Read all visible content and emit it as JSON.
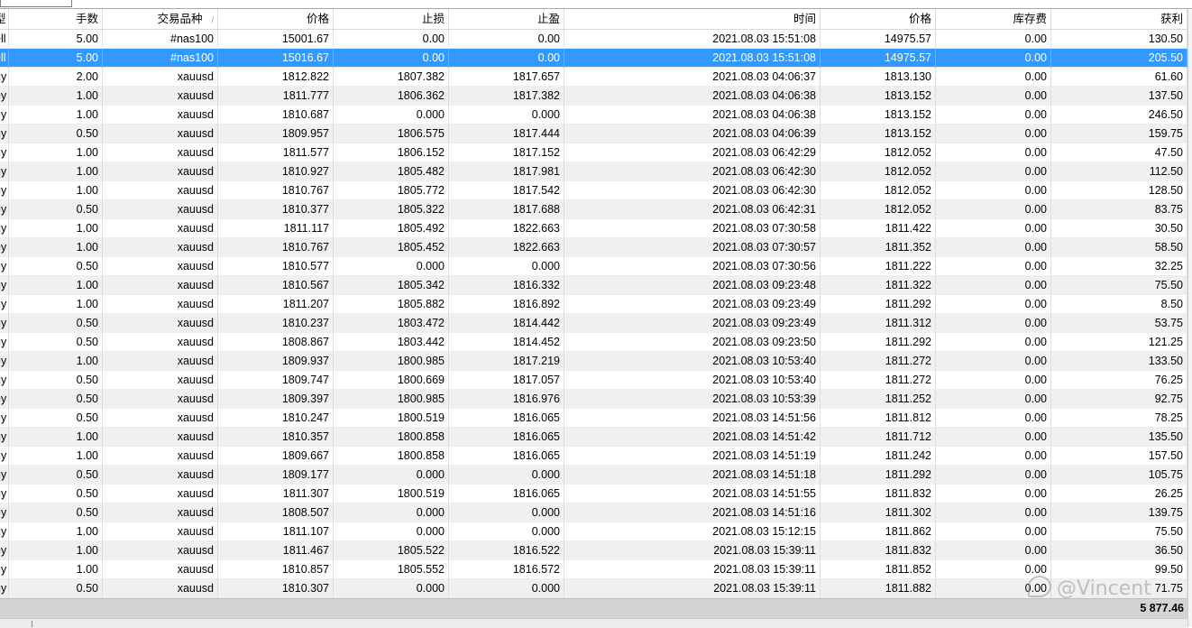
{
  "columns": {
    "type": "型",
    "lots": "手数",
    "symbol": "交易品种",
    "open_price": "价格",
    "sl": "止损",
    "tp": "止盈",
    "time": "时间",
    "price": "价格",
    "swap": "库存费",
    "profit": "获利"
  },
  "sort_indicator": "/",
  "rows": [
    [
      "ell",
      "5.00",
      "#nas100",
      "15001.67",
      "0.00",
      "0.00",
      "2021.08.03 15:51:08",
      "14975.57",
      "0.00",
      "130.50"
    ],
    [
      "ell",
      "5.00",
      "#nas100",
      "15016.67",
      "0.00",
      "0.00",
      "2021.08.03 15:51:08",
      "14975.57",
      "0.00",
      "205.50"
    ],
    [
      "uy",
      "2.00",
      "xauusd",
      "1812.822",
      "1807.382",
      "1817.657",
      "2021.08.03 04:06:37",
      "1813.130",
      "0.00",
      "61.60"
    ],
    [
      "uy",
      "1.00",
      "xauusd",
      "1811.777",
      "1806.362",
      "1817.382",
      "2021.08.03 04:06:38",
      "1813.152",
      "0.00",
      "137.50"
    ],
    [
      "uy",
      "1.00",
      "xauusd",
      "1810.687",
      "0.000",
      "0.000",
      "2021.08.03 04:06:38",
      "1813.152",
      "0.00",
      "246.50"
    ],
    [
      "uy",
      "0.50",
      "xauusd",
      "1809.957",
      "1806.575",
      "1817.444",
      "2021.08.03 04:06:39",
      "1813.152",
      "0.00",
      "159.75"
    ],
    [
      "uy",
      "1.00",
      "xauusd",
      "1811.577",
      "1806.152",
      "1817.152",
      "2021.08.03 06:42:29",
      "1812.052",
      "0.00",
      "47.50"
    ],
    [
      "uy",
      "1.00",
      "xauusd",
      "1810.927",
      "1805.482",
      "1817.981",
      "2021.08.03 06:42:30",
      "1812.052",
      "0.00",
      "112.50"
    ],
    [
      "uy",
      "1.00",
      "xauusd",
      "1810.767",
      "1805.772",
      "1817.542",
      "2021.08.03 06:42:30",
      "1812.052",
      "0.00",
      "128.50"
    ],
    [
      "uy",
      "0.50",
      "xauusd",
      "1810.377",
      "1805.322",
      "1817.688",
      "2021.08.03 06:42:31",
      "1812.052",
      "0.00",
      "83.75"
    ],
    [
      "uy",
      "1.00",
      "xauusd",
      "1811.117",
      "1805.492",
      "1822.663",
      "2021.08.03 07:30:58",
      "1811.422",
      "0.00",
      "30.50"
    ],
    [
      "uy",
      "1.00",
      "xauusd",
      "1810.767",
      "1805.452",
      "1822.663",
      "2021.08.03 07:30:57",
      "1811.352",
      "0.00",
      "58.50"
    ],
    [
      "uy",
      "0.50",
      "xauusd",
      "1810.577",
      "0.000",
      "0.000",
      "2021.08.03 07:30:56",
      "1811.222",
      "0.00",
      "32.25"
    ],
    [
      "uy",
      "1.00",
      "xauusd",
      "1810.567",
      "1805.342",
      "1816.332",
      "2021.08.03 09:23:48",
      "1811.322",
      "0.00",
      "75.50"
    ],
    [
      "uy",
      "1.00",
      "xauusd",
      "1811.207",
      "1805.882",
      "1816.892",
      "2021.08.03 09:23:49",
      "1811.292",
      "0.00",
      "8.50"
    ],
    [
      "uy",
      "0.50",
      "xauusd",
      "1810.237",
      "1803.472",
      "1814.442",
      "2021.08.03 09:23:49",
      "1811.312",
      "0.00",
      "53.75"
    ],
    [
      "uy",
      "0.50",
      "xauusd",
      "1808.867",
      "1803.442",
      "1814.452",
      "2021.08.03 09:23:50",
      "1811.292",
      "0.00",
      "121.25"
    ],
    [
      "uy",
      "1.00",
      "xauusd",
      "1809.937",
      "1800.985",
      "1817.219",
      "2021.08.03 10:53:40",
      "1811.272",
      "0.00",
      "133.50"
    ],
    [
      "uy",
      "0.50",
      "xauusd",
      "1809.747",
      "1800.669",
      "1817.057",
      "2021.08.03 10:53:40",
      "1811.272",
      "0.00",
      "76.25"
    ],
    [
      "uy",
      "0.50",
      "xauusd",
      "1809.397",
      "1800.985",
      "1816.976",
      "2021.08.03 10:53:39",
      "1811.252",
      "0.00",
      "92.75"
    ],
    [
      "uy",
      "0.50",
      "xauusd",
      "1810.247",
      "1800.519",
      "1816.065",
      "2021.08.03 14:51:56",
      "1811.812",
      "0.00",
      "78.25"
    ],
    [
      "uy",
      "1.00",
      "xauusd",
      "1810.357",
      "1800.858",
      "1816.065",
      "2021.08.03 14:51:42",
      "1811.712",
      "0.00",
      "135.50"
    ],
    [
      "uy",
      "1.00",
      "xauusd",
      "1809.667",
      "1800.858",
      "1816.065",
      "2021.08.03 14:51:19",
      "1811.242",
      "0.00",
      "157.50"
    ],
    [
      "uy",
      "0.50",
      "xauusd",
      "1809.177",
      "0.000",
      "0.000",
      "2021.08.03 14:51:18",
      "1811.292",
      "0.00",
      "105.75"
    ],
    [
      "uy",
      "0.50",
      "xauusd",
      "1811.307",
      "1800.519",
      "1816.065",
      "2021.08.03 14:51:55",
      "1811.832",
      "0.00",
      "26.25"
    ],
    [
      "uy",
      "0.50",
      "xauusd",
      "1808.507",
      "0.000",
      "0.000",
      "2021.08.03 14:51:16",
      "1811.302",
      "0.00",
      "139.75"
    ],
    [
      "uy",
      "1.00",
      "xauusd",
      "1811.107",
      "0.000",
      "0.000",
      "2021.08.03 15:12:15",
      "1811.862",
      "0.00",
      "75.50"
    ],
    [
      "uy",
      "1.00",
      "xauusd",
      "1811.467",
      "1805.522",
      "1816.522",
      "2021.08.03 15:39:11",
      "1811.832",
      "0.00",
      "36.50"
    ],
    [
      "uy",
      "1.00",
      "xauusd",
      "1810.857",
      "1805.552",
      "1816.572",
      "2021.08.03 15:39:11",
      "1811.852",
      "0.00",
      "99.50"
    ],
    [
      "uy",
      "0.50",
      "xauusd",
      "1810.307",
      "0.000",
      "0.000",
      "2021.08.03 15:39:11",
      "1811.882",
      "0.00",
      "71.75"
    ]
  ],
  "selected_row": 1,
  "total_profit": "5 877.46",
  "watermark": "@Vincent",
  "colors": {
    "selection": "#3399ff",
    "alt_row": "#f0f0f0",
    "footer": "#d4d4d4"
  }
}
